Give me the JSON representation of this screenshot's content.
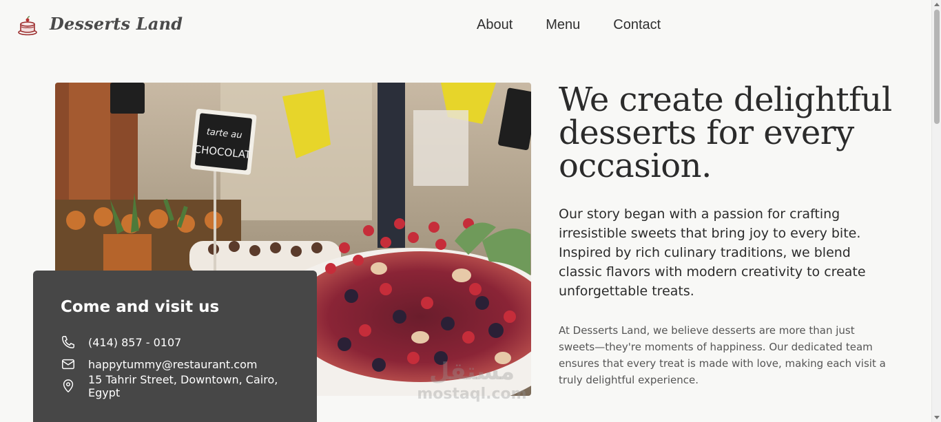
{
  "header": {
    "brand": "Desserts Land",
    "logo_icon": "cake-icon",
    "nav": [
      "About",
      "Menu",
      "Contact"
    ]
  },
  "hero": {
    "headline": "We create delightful desserts for every occasion.",
    "story": "Our story began with a passion for crafting irresistible sweets that bring joy to every bite. Inspired by rich culinary traditions, we blend classic flavors with modern creativity to create unforgettable treats.",
    "belief": "At Desserts Land, we believe desserts are more than just sweets—they're moments of happiness. Our dedicated team ensures that every treat is made with love, making each visit a truly delightful experience.",
    "image_signs": [
      "tarte au",
      "CHOCOLAT"
    ]
  },
  "visit": {
    "title": "Come and visit us",
    "phone": "(414) 857 - 0107",
    "email": "happytummy@restaurant.com",
    "address": "15 Tahrir Street, Downtown, Cairo, Egypt"
  },
  "watermark": {
    "logo_text": "مستقل",
    "site": "mostaql.com"
  },
  "colors": {
    "background": "#f8f8f6",
    "card": "#474747",
    "text_dark": "#2b2b2b",
    "text_muted": "#555555"
  }
}
